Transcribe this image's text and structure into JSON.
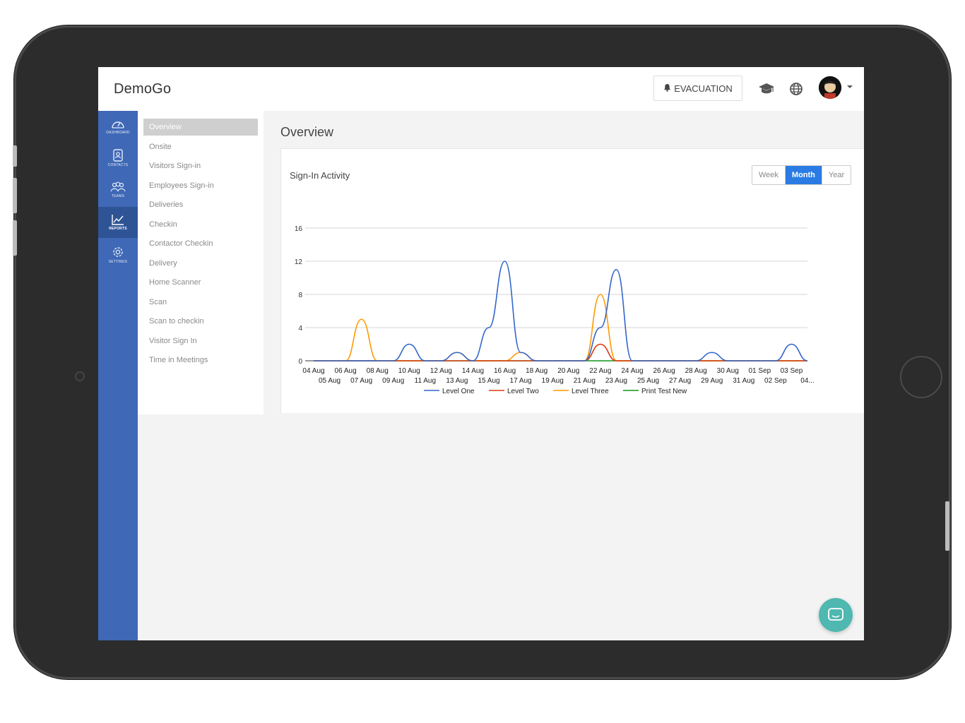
{
  "app": {
    "title": "DemoGo"
  },
  "header": {
    "evacuation_label": "EVACUATION"
  },
  "rail": {
    "items": [
      {
        "label": "DASHBOARD",
        "icon": "speedometer-icon"
      },
      {
        "label": "CONTACTS",
        "icon": "contacts-icon"
      },
      {
        "label": "TEAMS",
        "icon": "teams-icon"
      },
      {
        "label": "REPORTS",
        "icon": "chart-icon",
        "active": true
      },
      {
        "label": "SETTINGS",
        "icon": "gear-icon"
      }
    ]
  },
  "submenu": {
    "items": [
      "Overview",
      "Onsite",
      "Visitors Sign-in",
      "Employees Sign-in",
      "Deliveries",
      "Checkin",
      "Contactor Checkin",
      "Delivery",
      "Home Scanner",
      "Scan",
      "Scan to checkin",
      "Visitor Sign In",
      "Time in Meetings"
    ],
    "active_index": 0
  },
  "main": {
    "title": "Overview",
    "card_title": "Sign-In Activity",
    "range_buttons": [
      "Week",
      "Month",
      "Year"
    ],
    "range_active": "Month"
  },
  "colors": {
    "level_one": "#3366cc",
    "level_two": "#dc3912",
    "level_three": "#ff9900",
    "print_test_new": "#109618",
    "rail": "#3f68b6",
    "accent": "#2a7be4"
  },
  "chart_data": {
    "type": "line",
    "ylim": [
      0,
      16
    ],
    "yticks": [
      0,
      4,
      8,
      12,
      16
    ],
    "x": [
      "04 Aug",
      "05 Aug",
      "06 Aug",
      "07 Aug",
      "08 Aug",
      "09 Aug",
      "10 Aug",
      "11 Aug",
      "12 Aug",
      "13 Aug",
      "14 Aug",
      "15 Aug",
      "16 Aug",
      "17 Aug",
      "18 Aug",
      "19 Aug",
      "20 Aug",
      "21 Aug",
      "22 Aug",
      "23 Aug",
      "24 Aug",
      "25 Aug",
      "26 Aug",
      "27 Aug",
      "28 Aug",
      "29 Aug",
      "30 Aug",
      "31 Aug",
      "01 Sep",
      "02 Sep",
      "03 Sep",
      "04 Sep"
    ],
    "xtick_labels_row1": [
      "04 Aug",
      "06 Aug",
      "08 Aug",
      "10 Aug",
      "12 Aug",
      "14 Aug",
      "16 Aug",
      "18 Aug",
      "20 Aug",
      "22 Aug",
      "24 Aug",
      "26 Aug",
      "28 Aug",
      "30 Aug",
      "01 Sep",
      "03 Sep"
    ],
    "xtick_labels_row2": [
      "05 Aug",
      "07 Aug",
      "09 Aug",
      "11 Aug",
      "13 Aug",
      "15 Aug",
      "17 Aug",
      "19 Aug",
      "21 Aug",
      "23 Aug",
      "25 Aug",
      "27 Aug",
      "29 Aug",
      "31 Aug",
      "02 Sep",
      "04..."
    ],
    "series": [
      {
        "name": "Level One",
        "color": "#3366cc",
        "values": [
          0,
          0,
          0,
          0,
          0,
          0,
          2,
          0,
          0,
          1,
          0,
          4,
          12,
          1,
          0,
          0,
          0,
          0,
          4,
          11,
          0,
          0,
          0,
          0,
          0,
          1,
          0,
          0,
          0,
          0,
          2,
          0
        ]
      },
      {
        "name": "Level Two",
        "color": "#dc3912",
        "values": [
          0,
          0,
          0,
          0,
          0,
          0,
          0,
          0,
          0,
          0,
          0,
          0,
          0,
          0,
          0,
          0,
          0,
          0,
          2,
          0,
          0,
          0,
          0,
          0,
          0,
          0,
          0,
          0,
          0,
          0,
          0,
          0
        ]
      },
      {
        "name": "Level Three",
        "color": "#ff9900",
        "values": [
          0,
          0,
          0,
          5,
          0,
          0,
          0,
          0,
          0,
          1,
          0,
          0,
          0,
          1,
          0,
          0,
          0,
          0,
          8,
          0,
          0,
          0,
          0,
          0,
          0,
          0,
          0,
          0,
          0,
          0,
          0,
          0
        ]
      },
      {
        "name": "Print Test New",
        "color": "#109618",
        "values": [
          0,
          0,
          0,
          0,
          0,
          0,
          0,
          0,
          0,
          0,
          0,
          0,
          0,
          0,
          0,
          0,
          0,
          0,
          0,
          0,
          0,
          0,
          0,
          0,
          0,
          0,
          0,
          0,
          0,
          0,
          0,
          0
        ]
      }
    ],
    "legend": "bottom",
    "grid": true
  }
}
